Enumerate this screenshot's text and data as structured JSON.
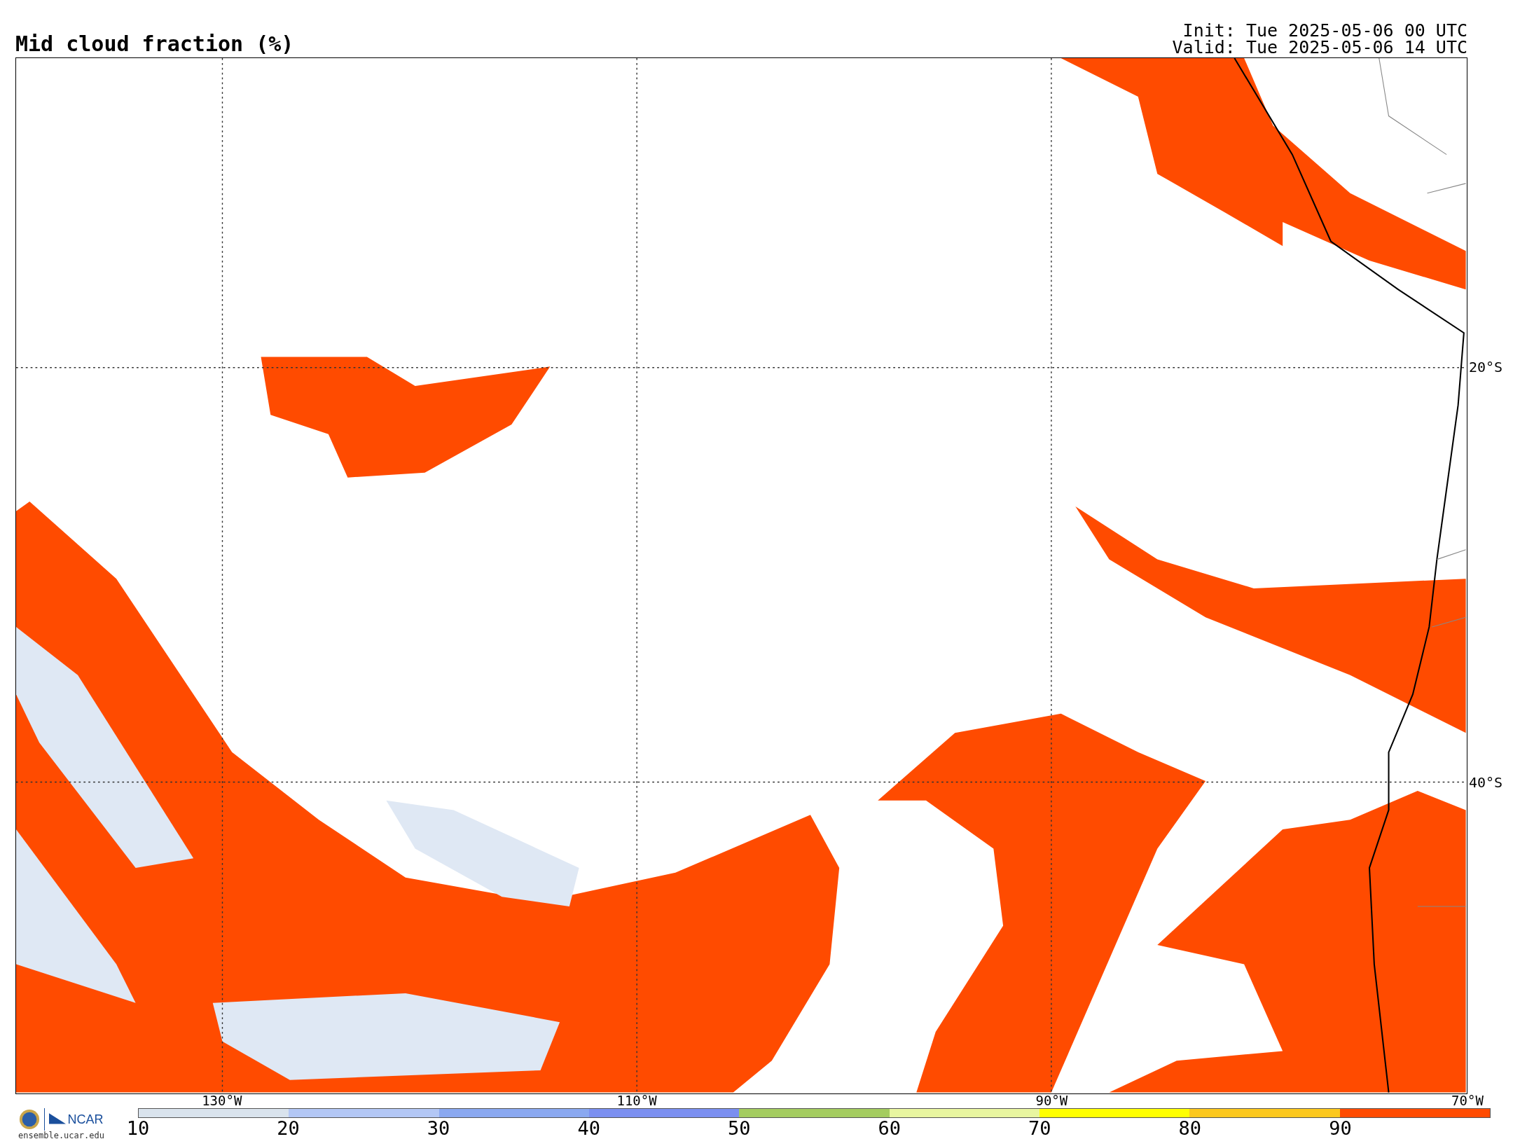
{
  "title": "Mid cloud fraction (%)",
  "init": "Init: Tue 2025-05-06 00 UTC",
  "valid": "Valid: Tue 2025-05-06 14 UTC",
  "map": {
    "lon_labels": [
      "130°W",
      "110°W",
      "90°W",
      "70°W"
    ],
    "lat_labels": [
      "20°S",
      "40°S"
    ]
  },
  "colorbar": {
    "segments": [
      {
        "color": "#d9e3ed"
      },
      {
        "color": "#b3c7f5"
      },
      {
        "color": "#8aa8f0"
      },
      {
        "color": "#7b8ff0"
      },
      {
        "color": "#a4cc60"
      },
      {
        "color": "#e8f5a0"
      },
      {
        "color": "#ffff00"
      },
      {
        "color": "#fcc81e"
      },
      {
        "color": "#ff4b00"
      }
    ],
    "ticks": [
      "10",
      "20",
      "30",
      "40",
      "50",
      "60",
      "70",
      "80",
      "90"
    ]
  },
  "logo": {
    "wordmark": "NCAR",
    "url": "ensemble.ucar.edu"
  }
}
